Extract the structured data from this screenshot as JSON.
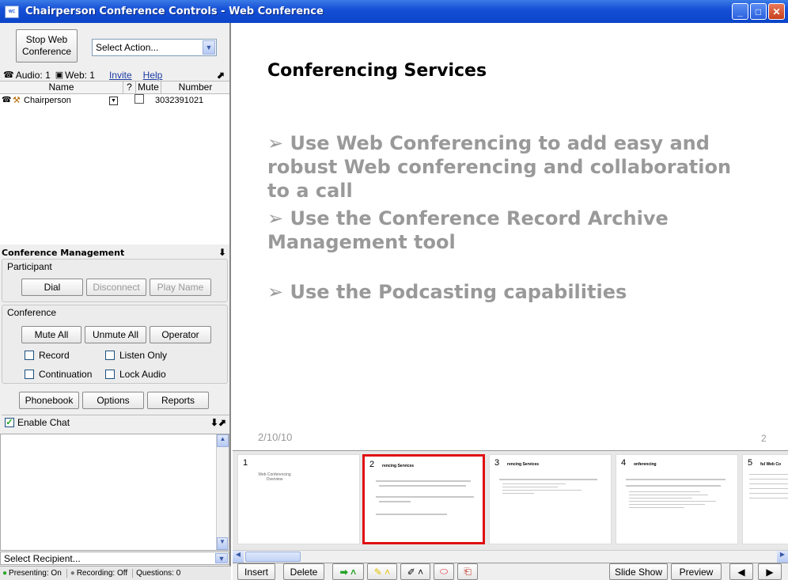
{
  "window": {
    "title": "Chairperson Conference Controls - Web Conference",
    "app_icon_text": "WC"
  },
  "left": {
    "stop_button": "Stop Web Conference",
    "action_select": "Select Action...",
    "audio_count": "Audio: 1",
    "web_count": "Web: 1",
    "invite_link": "Invite",
    "help_link": "Help",
    "columns": {
      "name": "Name",
      "q": "?",
      "mute": "Mute",
      "number": "Number"
    },
    "participants": [
      {
        "name": "Chairperson",
        "number": "3032391021"
      }
    ],
    "mgmt_title": "Conference Management",
    "participant_label": "Participant",
    "dial": "Dial",
    "disconnect": "Disconnect",
    "play_name": "Play Name",
    "conference_label": "Conference",
    "mute_all": "Mute All",
    "unmute_all": "Unmute All",
    "operator": "Operator",
    "record": "Record",
    "listen_only": "Listen Only",
    "continuation": "Continuation",
    "lock_audio": "Lock Audio",
    "phonebook": "Phonebook",
    "options": "Options",
    "reports": "Reports",
    "enable_chat": "Enable Chat",
    "recipient": "Select Recipient...",
    "status": {
      "presenting": "Presenting: On",
      "recording": "Recording: Off",
      "questions": "Questions: 0"
    }
  },
  "slide": {
    "title": "Conferencing Services",
    "bullets": [
      "Use Web Conferencing to add easy and robust Web conferencing and collaboration to a call",
      "Use the Conference Record Archive Management tool",
      "Use the Podcasting capabilities"
    ],
    "date": "2/10/10",
    "page": "2"
  },
  "thumbnails": [
    {
      "num": "1",
      "title": "Web Conferencing Overview"
    },
    {
      "num": "2",
      "title": "rencing Services"
    },
    {
      "num": "3",
      "title": "rencing Services"
    },
    {
      "num": "4",
      "title": "onferencing"
    },
    {
      "num": "5",
      "title": "ful Web Co"
    }
  ],
  "toolbar": {
    "insert": "Insert",
    "delete": "Delete",
    "slideshow": "Slide Show",
    "preview": "Preview"
  }
}
